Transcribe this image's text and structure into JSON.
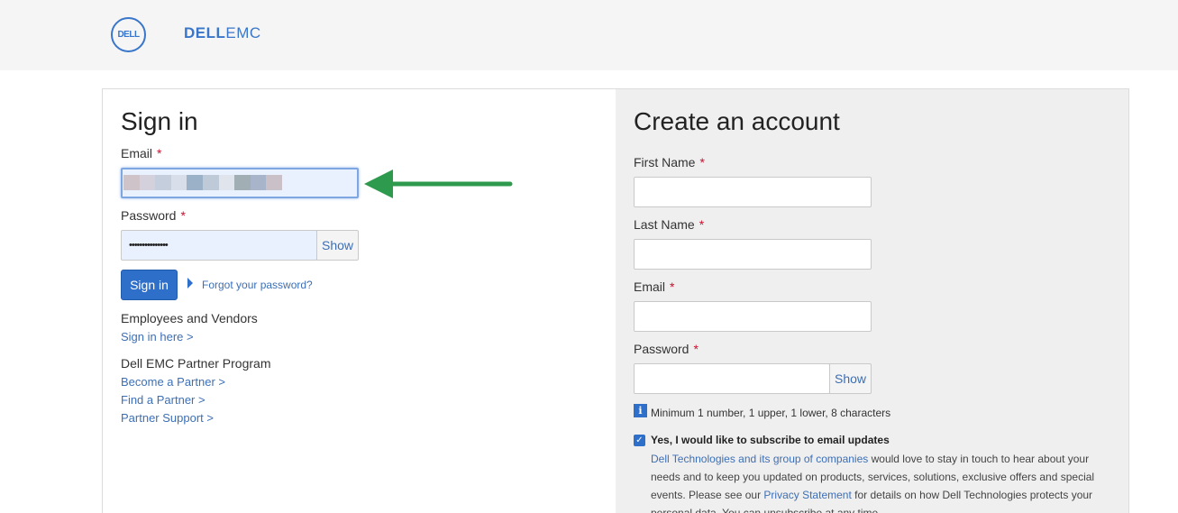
{
  "header": {
    "dell_logo_text": "DELL",
    "dellemc_bold": "DELL",
    "dellemc_light": "EMC"
  },
  "signin": {
    "title": "Sign in",
    "email_label": "Email",
    "password_label": "Password",
    "required_mark": "*",
    "password_value": "•••••••••••••••",
    "show_label": "Show",
    "signin_button": "Sign in",
    "forgot_link": "Forgot your password?",
    "employees_heading": "Employees and Vendors",
    "employees_link": "Sign in here >",
    "partner_heading": "Dell EMC Partner Program",
    "partner_links": [
      "Become a Partner >",
      "Find a Partner >",
      "Partner Support >"
    ],
    "email_redacted_colors": [
      "#cdc3c8",
      "#d4d1dc",
      "#c4cedd",
      "#d8dfea",
      "#9bb1c7",
      "#bfcad8",
      "#e0e4ec",
      "#a1aeb3",
      "#a7b4c9",
      "#c9c0c8"
    ]
  },
  "create": {
    "title": "Create an account",
    "first_name_label": "First Name",
    "last_name_label": "Last Name",
    "email_label": "Email",
    "password_label": "Password",
    "required_mark": "*",
    "show_label": "Show",
    "password_hint": "Minimum 1 number, 1 upper, 1 lower, 8 characters",
    "subscribe_label": "Yes, I would like to subscribe to email updates",
    "para_link1": "Dell Technologies and its group of companies",
    "para_text1": " would love to stay in touch to hear about your needs and to keep you updated on products, services, solutions, exclusive offers and special events. Please see our ",
    "para_link2": "Privacy Statement",
    "para_text2": " for details on how Dell Technologies protects your personal data. You can unsubscribe at any time."
  },
  "colors": {
    "accent": "#2e6fca",
    "arrow": "#2e9a4e",
    "required": "#c8102e"
  }
}
